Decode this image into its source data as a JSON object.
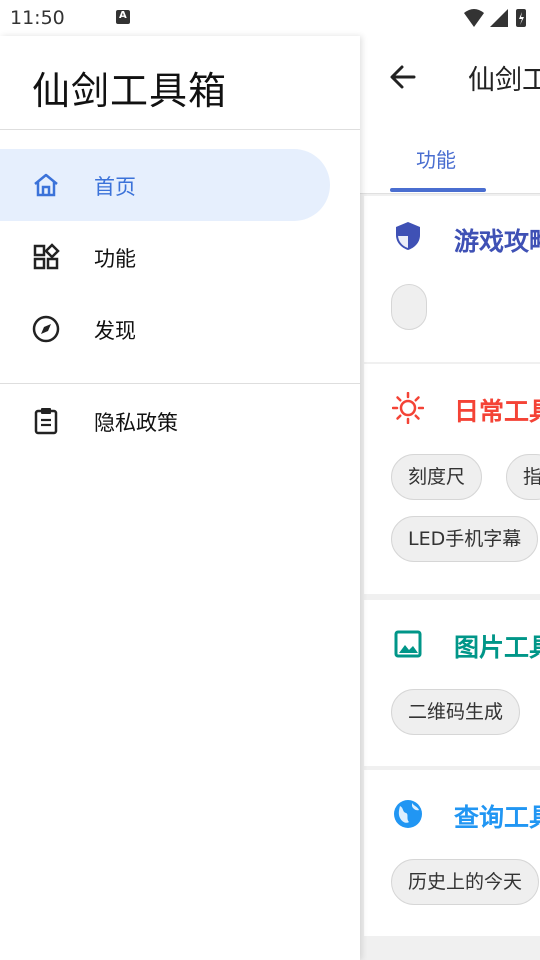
{
  "status_bar": {
    "time": "11:50"
  },
  "drawer": {
    "title": "仙剑工具箱",
    "items": [
      {
        "label": "首页",
        "icon": "home-icon",
        "active": true
      },
      {
        "label": "功能",
        "icon": "widgets-icon",
        "active": false
      },
      {
        "label": "发现",
        "icon": "compass-icon",
        "active": false
      }
    ],
    "secondary_items": [
      {
        "label": "隐私政策",
        "icon": "clipboard-icon"
      }
    ]
  },
  "main": {
    "appbar_title": "仙剑工",
    "tabs": [
      {
        "label": "功能"
      }
    ],
    "sections": [
      {
        "title": "游戏攻略",
        "icon": "shield-icon",
        "color": "#3f51b5",
        "chips": [
          ""
        ]
      },
      {
        "title": "日常工具",
        "icon": "sun-icon",
        "color": "#f44336",
        "chips": [
          "刻度尺",
          "指",
          "LED手机字幕"
        ]
      },
      {
        "title": "图片工具",
        "icon": "image-icon",
        "color": "#009688",
        "chips": [
          "二维码生成"
        ]
      },
      {
        "title": "查询工具",
        "icon": "globe-icon",
        "color": "#2196f3",
        "chips": [
          "历史上的今天"
        ]
      }
    ]
  },
  "colors": {
    "accent": "#3b72d9",
    "active_bg": "#e6effd"
  }
}
